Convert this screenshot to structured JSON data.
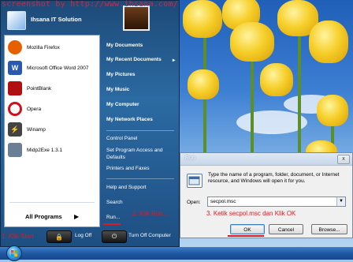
{
  "watermark": "screenshot by http://www.ihsana.com/",
  "start_menu": {
    "user_name": "Ihsana IT Solution",
    "programs": [
      {
        "label": "Mozilla Firefox",
        "icon": "firefox-icon",
        "color": "#e66000"
      },
      {
        "label": "Microsoft Office Word 2007",
        "icon": "word-icon",
        "color": "#2a5ab0"
      },
      {
        "label": "PointBlank",
        "icon": "pointblank-icon",
        "color": "#b01010"
      },
      {
        "label": "Opera",
        "icon": "opera-icon",
        "color": "#d0101a"
      },
      {
        "label": "Winamp",
        "icon": "winamp-icon",
        "color": "#444444"
      },
      {
        "label": "Midp2Exe 1.3.1",
        "icon": "midp2exe-icon",
        "color": "#6a7f96"
      }
    ],
    "all_programs": "All Programs",
    "right_items": [
      "My Documents",
      "My Recent Documents",
      "My Pictures",
      "My Music",
      "My Computer",
      "My Network Places",
      "Control Panel",
      "Set Program Access and",
      "Defaults",
      "Printers and Faxes",
      "Help and Support",
      "Search",
      "Run..."
    ],
    "log_off": "Log Off",
    "turn_off": "Turn Off Computer"
  },
  "annotations": {
    "step1": "1. Klik Start",
    "step2": "2. Klik Run...",
    "step3": "3. Ketik secpol.msc dan Klik OK"
  },
  "run_dialog": {
    "title": "Run",
    "close": "x",
    "description": "Type the name of a program, folder, document, or Internet resource, and Windows will open it for you.",
    "open_label": "Open:",
    "open_value": "secpol.msc",
    "ok": "OK",
    "cancel": "Cancel",
    "browse": "Browse..."
  },
  "colors": {
    "annotation": "#e01822",
    "menu_blue": "#2b6aa2"
  }
}
